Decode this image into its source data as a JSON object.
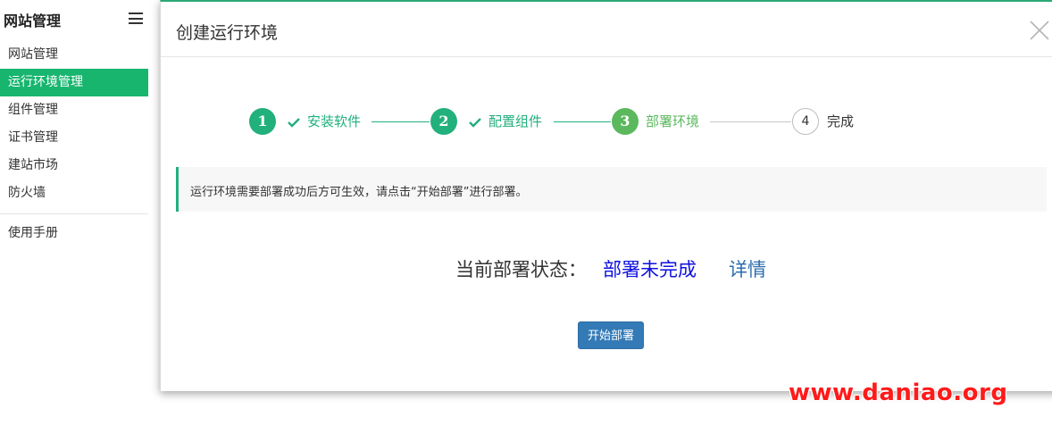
{
  "sidebar": {
    "title": "网站管理",
    "items": [
      {
        "label": "网站管理"
      },
      {
        "label": "运行环境管理",
        "active": true
      },
      {
        "label": "组件管理"
      },
      {
        "label": "证书管理"
      },
      {
        "label": "建站市场"
      },
      {
        "label": "防火墙"
      },
      {
        "label": "使用手册"
      }
    ]
  },
  "modal": {
    "title": "创建运行环境",
    "steps": [
      {
        "number": "1",
        "label": "安装软件",
        "state": "done"
      },
      {
        "number": "2",
        "label": "配置组件",
        "state": "done"
      },
      {
        "number": "3",
        "label": "部署环境",
        "state": "current"
      },
      {
        "number": "4",
        "label": "完成",
        "state": "pending"
      }
    ],
    "alert_text": "运行环境需要部署成功后方可生效，请点击“开始部署”进行部署。",
    "status_label": "当前部署状态：",
    "status_value": "部署未完成",
    "status_detail": "详情",
    "start_button": "开始部署"
  },
  "watermark": "www.daniao.org",
  "colors": {
    "accent": "#18b56f",
    "step_done": "#22b07d",
    "step_current": "#5bb85d",
    "primary_button": "#337ab7",
    "status_value": "#1010e0",
    "link": "#2e6dad",
    "watermark": "#ff1a1a"
  }
}
